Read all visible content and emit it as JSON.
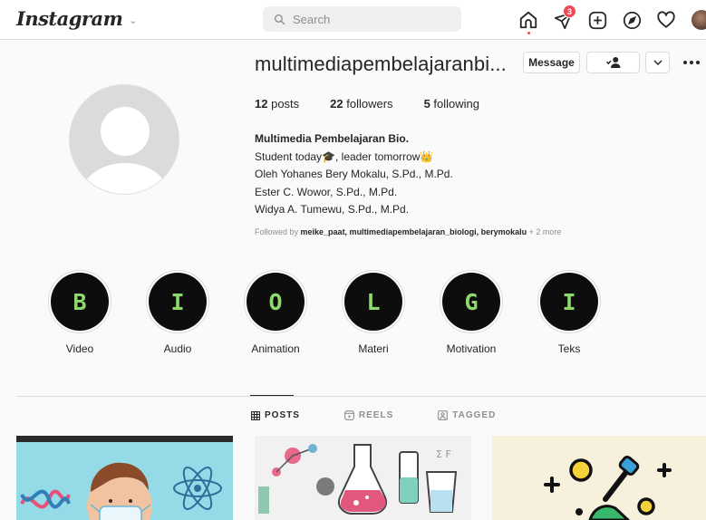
{
  "nav": {
    "logo": "Instagram",
    "search_placeholder": "Search",
    "notification_count": "3"
  },
  "profile": {
    "username": "multimediapembelajaranbi...",
    "message_label": "Message",
    "stats": {
      "posts_count": "12",
      "posts_label": "posts",
      "followers_count": "22",
      "followers_label": "followers",
      "following_count": "5",
      "following_label": "following"
    },
    "bio": {
      "name": "Multimedia Pembelajaran Bio.",
      "line1": "Student today🎓, leader tomorrow👑",
      "line2": "Oleh Yohanes Bery Mokalu, S.Pd., M.Pd.",
      "line3": "Ester C. Wowor, S.Pd., M.Pd.",
      "line4": "Widya A. Tumewu, S.Pd., M.Pd."
    },
    "followed_by": {
      "prefix": "Followed by ",
      "names": "meike_paat, multimediapembelajaran_biologi, berymokalu",
      "more": " + 2 more"
    }
  },
  "highlights": [
    {
      "letter": "B",
      "label": "Video"
    },
    {
      "letter": "I",
      "label": "Audio"
    },
    {
      "letter": "O",
      "label": "Animation"
    },
    {
      "letter": "L",
      "label": "Materi"
    },
    {
      "letter": "G",
      "label": "Motivation"
    },
    {
      "letter": "I",
      "label": "Teks"
    }
  ],
  "tabs": {
    "posts": "POSTS",
    "reels": "REELS",
    "tagged": "TAGGED"
  },
  "colors": {
    "badge_red": "#ed4956",
    "highlight_letter_green": "#8fd96b",
    "highlight_bg": "#0d0d0d"
  }
}
